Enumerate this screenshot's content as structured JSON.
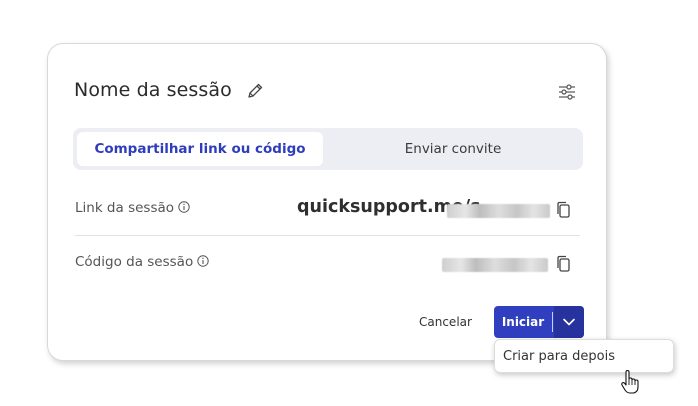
{
  "dialog": {
    "title": "Nome da sessão",
    "edit_icon": "pencil-icon",
    "settings_icon": "sliders-icon"
  },
  "tabs": [
    {
      "label": "Compartilhar link ou código",
      "active": true
    },
    {
      "label": "Enviar convite",
      "active": false
    }
  ],
  "session_link": {
    "label": "Link da sessão",
    "value_prefix": "quicksupport.me/s",
    "info_icon": "info-icon",
    "copy_icon": "copy-icon"
  },
  "session_code": {
    "label": "Código da sessão",
    "info_icon": "info-icon",
    "copy_icon": "copy-icon"
  },
  "actions": {
    "cancel_label": "Cancelar",
    "start_label": "Iniciar",
    "dropdown_icon": "chevron-down-icon"
  },
  "dropdown_menu": {
    "items": [
      "Criar para depois"
    ]
  },
  "colors": {
    "accent": "#2f3fbf",
    "accent_dark": "#26339f",
    "tab_bg": "#eceef3",
    "active_tab_text": "#2e3dbd"
  }
}
